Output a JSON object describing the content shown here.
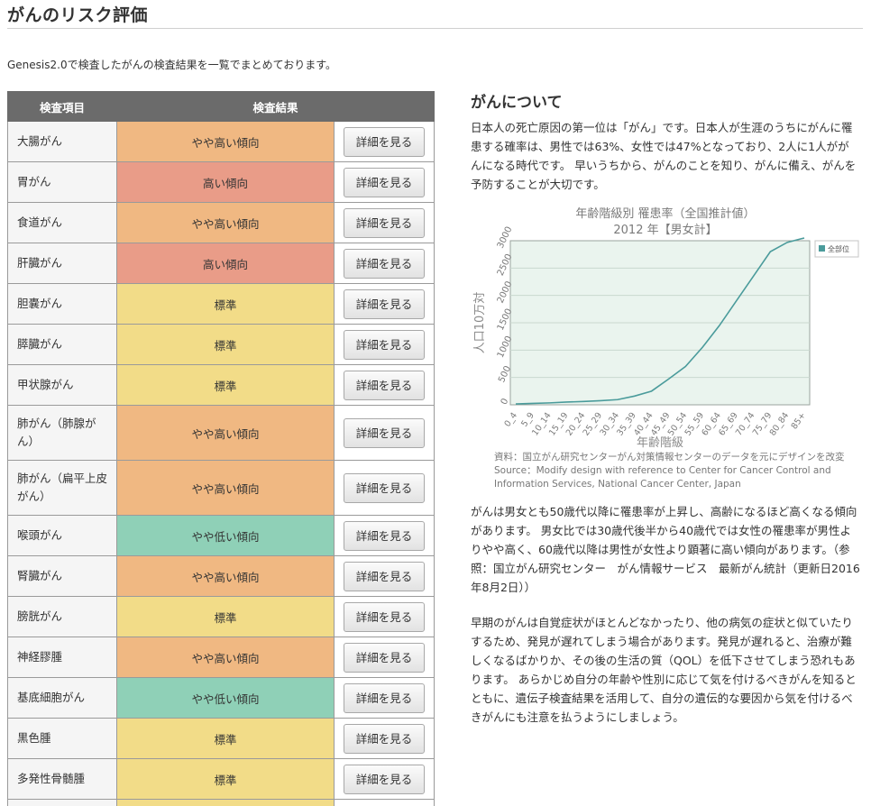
{
  "page": {
    "title": "がんのリスク評価",
    "intro": "Genesis2.0で検査したがんの検査結果を一覧でまとめております。"
  },
  "table": {
    "headers": {
      "item": "検査項目",
      "result": "検査結果"
    },
    "button_label": "詳細を見る",
    "rows": [
      {
        "name": "大腸がん",
        "result": "やや高い傾向",
        "level": "slight-high",
        "tall": false
      },
      {
        "name": "胃がん",
        "result": "高い傾向",
        "level": "high",
        "tall": false
      },
      {
        "name": "食道がん",
        "result": "やや高い傾向",
        "level": "slight-high",
        "tall": false
      },
      {
        "name": "肝臓がん",
        "result": "高い傾向",
        "level": "high",
        "tall": false
      },
      {
        "name": "胆嚢がん",
        "result": "標準",
        "level": "standard",
        "tall": false
      },
      {
        "name": "膵臓がん",
        "result": "標準",
        "level": "standard",
        "tall": false
      },
      {
        "name": "甲状腺がん",
        "result": "標準",
        "level": "standard",
        "tall": false
      },
      {
        "name": "肺がん（肺腺がん）",
        "result": "やや高い傾向",
        "level": "slight-high",
        "tall": true
      },
      {
        "name": "肺がん（扁平上皮がん）",
        "result": "やや高い傾向",
        "level": "slight-high",
        "tall": true
      },
      {
        "name": "喉頭がん",
        "result": "やや低い傾向",
        "level": "slight-low",
        "tall": false
      },
      {
        "name": "腎臓がん",
        "result": "やや高い傾向",
        "level": "slight-high",
        "tall": false
      },
      {
        "name": "膀胱がん",
        "result": "標準",
        "level": "standard",
        "tall": false
      },
      {
        "name": "神経膠腫",
        "result": "やや高い傾向",
        "level": "slight-high",
        "tall": false
      },
      {
        "name": "基底細胞がん",
        "result": "やや低い傾向",
        "level": "slight-low",
        "tall": false
      },
      {
        "name": "黒色腫",
        "result": "標準",
        "level": "standard",
        "tall": false
      },
      {
        "name": "多発性骨髄腫",
        "result": "標準",
        "level": "standard",
        "tall": false
      }
    ],
    "colors": {
      "slight-high": "#f0b882",
      "high": "#e99c88",
      "standard": "#f2dc88",
      "slight-low": "#8fd0b7"
    }
  },
  "about": {
    "title": "がんについて",
    "para1": "日本人の死亡原因の第一位は「がん」です。日本人が生涯のうちにがんに罹患する確率は、男性では63%、女性では47%となっており、2人に1人ががんになる時代です。 早いうちから、がんのことを知り、がんに備え、がんを予防することが大切です。",
    "para2": "がんは男女とも50歳代以降に罹患率が上昇し、高齢になるほど高くなる傾向があります。 男女比では30歳代後半から40歳代では女性の罹患率が男性よりやや高く、60歳代以降は男性が女性より顕著に高い傾向があります。（参照：国立がん研究センター　がん情報サービス　最新がん統計（更新日2016年8月2日））",
    "para3": "早期のがんは自覚症状がほとんどなかったり、他の病気の症状と似ていたりするため、発見が遅れてしまう場合があります。発見が遅れると、治療が難しくなるばかりか、その後の生活の質（QOL）を低下させてしまう恐れもあります。 あらかじめ自分の年齢や性別に応じて気を付けるべきがんを知るとともに、遺伝子検査結果を活用して、自分の遺伝的な要因から気を付けるべきがんにも注意を払うようにしましょう。"
  },
  "chart_data": {
    "type": "line",
    "title": "年齢階級別 罹患率（全国推計値）",
    "subtitle": "2012 年【男女計】",
    "xlabel": "年齢階級",
    "ylabel": "人口10万対",
    "categories": [
      "0_4",
      "5_9",
      "10_14",
      "15_19",
      "20_24",
      "25_29",
      "30_34",
      "35_39",
      "40_44",
      "45_49",
      "50_54",
      "55_59",
      "60_64",
      "65_69",
      "70_74",
      "75_79",
      "80_84",
      "85+"
    ],
    "series": [
      {
        "name": "全部位",
        "values": [
          15,
          25,
          35,
          50,
          60,
          75,
          95,
          160,
          250,
          470,
          700,
          1050,
          1450,
          1900,
          2350,
          2800,
          2970,
          3050
        ]
      }
    ],
    "ylim": [
      0,
      3000
    ],
    "yticks": [
      0,
      500,
      1000,
      1500,
      2000,
      2500,
      3000
    ],
    "grid": true,
    "legend_position": "right",
    "colors": {
      "line": "#4a9b9b",
      "plot_bg": "#eaf4ee",
      "grid": "#c9d8cf"
    },
    "source_ja": "資料：国立がん研究センターがん対策情報センターのデータを元にデザインを改変",
    "source_en": "Source：Modify design with reference to Center for Cancer Control and Information Services, National Cancer Center, Japan"
  }
}
